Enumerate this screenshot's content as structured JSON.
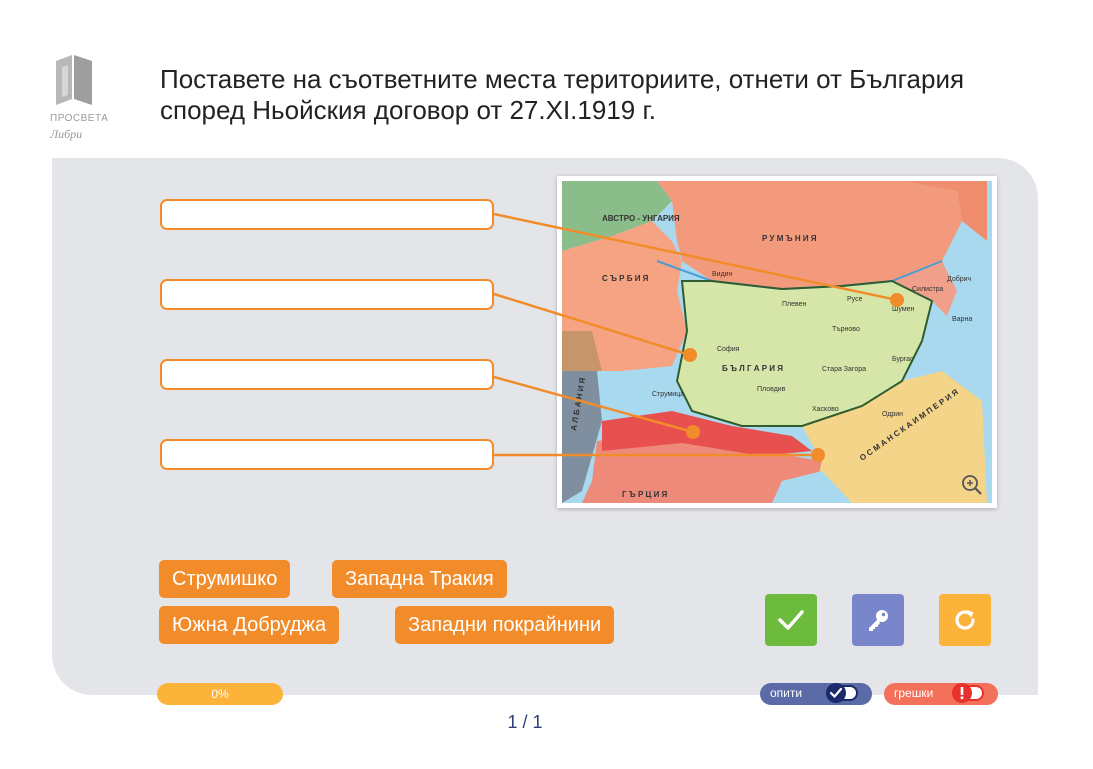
{
  "logo": {
    "line1": "ПРОСВЕТА",
    "line2": "Либри"
  },
  "question": "Поставете на съответните места териториите, отнети от България според Ньойския договор от 27.XI.1919 г.",
  "drop_targets": [
    {
      "value": ""
    },
    {
      "value": ""
    },
    {
      "value": ""
    },
    {
      "value": ""
    }
  ],
  "answer_options": [
    "Струмишко",
    "Западна Тракия",
    "Южна Добруджа",
    "Западни покрайнини"
  ],
  "map": {
    "labels": {
      "austria_hungary": "АВСТРО - УНГАРИЯ",
      "romania": "Р У М Ъ Н И Я",
      "serbia": "С Ъ Р Б И Я",
      "bulgaria": "Б Ъ Л Г А Р И Я",
      "ottoman": "О С М А Н С К А   И М П Е Р И Я",
      "greece": "Г Ъ Р Ц И Я",
      "albania": "А Л Б А Н И Я",
      "sofia": "София",
      "varna": "Варна",
      "tarnovo": "Търново",
      "plovdiv": "Пловдив",
      "stara_zagora": "Стара Загора",
      "burgas": "Бургас",
      "vidin": "Видин",
      "pleven": "Плевен",
      "ruse": "Русе",
      "shumen": "Шумен",
      "silistra": "Силистра",
      "haskovo": "Хасково",
      "edirne": "Одрин",
      "dobrich": "Добрич",
      "strumitsa": "Струмица"
    },
    "zoom_icon": "magnifier-plus-icon"
  },
  "buttons": {
    "check": "check-icon",
    "key": "key-icon",
    "reset": "reset-icon"
  },
  "progress": "0%",
  "pager": "1 / 1",
  "attempts_label": "опити",
  "errors_label": "грешки",
  "colors": {
    "accent": "#f28c2a",
    "panel": "#e4e5e9",
    "check": "#6cbb3c",
    "key": "#7986cb",
    "reset": "#fbb33a",
    "navy": "#1b2a6b",
    "error": "#f3705a"
  }
}
